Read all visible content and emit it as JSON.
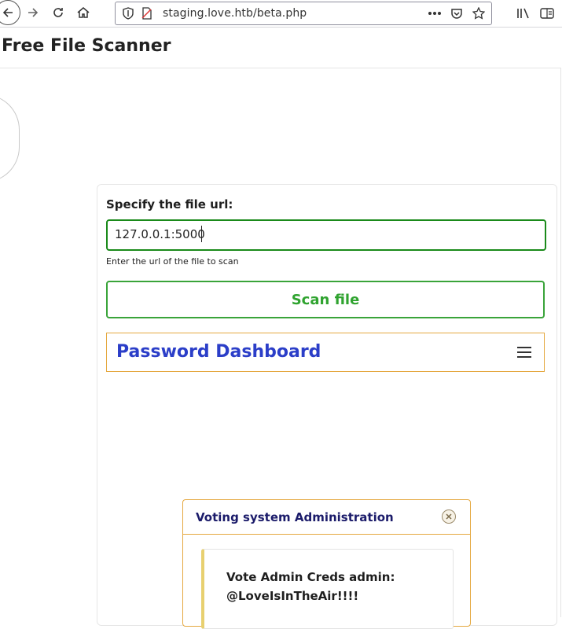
{
  "browser": {
    "url": "staging.love.htb/beta.php",
    "icons": {
      "back": "back-arrow-icon",
      "forward": "forward-arrow-icon",
      "reload": "reload-icon",
      "home": "home-icon",
      "shield": "shield-icon",
      "page": "page-icon",
      "more": "more-dots-icon",
      "pocket": "pocket-icon",
      "bookmark": "star-icon",
      "library": "library-icon",
      "reader": "reader-view-icon"
    }
  },
  "page": {
    "title": "Free File Scanner"
  },
  "form": {
    "label": "Specify the file url:",
    "url_value": "127.0.0.1:5000",
    "help_text": "Enter the url of the file to scan",
    "scan_button": "Scan file"
  },
  "dashboard": {
    "title": "Password Dashboard",
    "menu_icon": "hamburger-menu-icon"
  },
  "modal": {
    "title": "Voting system Administration",
    "close_icon": "close-icon",
    "creds_text": "Vote Admin Creds admin: @LoveIsInTheAir!!!!"
  },
  "colors": {
    "input_border": "#1a8a1a",
    "scan_button": "#2fa32f",
    "dashboard_title": "#2b3ec8",
    "accent_border": "#e5a840",
    "modal_title": "#1b1b6a"
  }
}
